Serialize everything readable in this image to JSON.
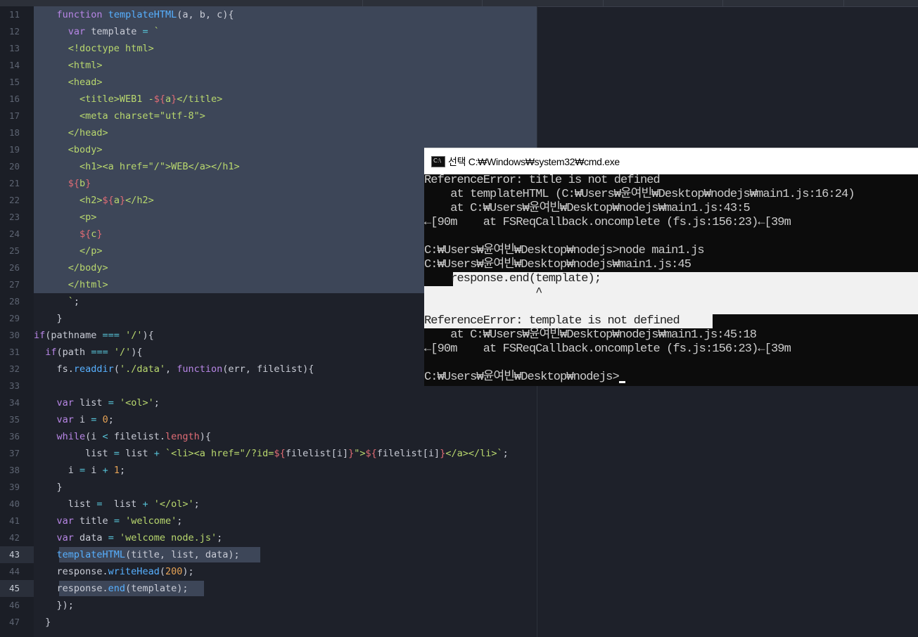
{
  "editor": {
    "lines": [
      {
        "n": "11",
        "parts": [
          [
            "",
            "    "
          ],
          [
            "kw",
            "function"
          ],
          [
            "",
            " "
          ],
          [
            "fn",
            "templateHTML"
          ],
          [
            "",
            "(a, b, c){"
          ]
        ]
      },
      {
        "n": "12",
        "parts": [
          [
            "",
            "      "
          ],
          [
            "kw",
            "var"
          ],
          [
            "",
            " template "
          ],
          [
            "op",
            "="
          ],
          [
            "",
            " "
          ],
          [
            "str",
            "`"
          ]
        ]
      },
      {
        "n": "13",
        "parts": [
          [
            "",
            "      "
          ],
          [
            "tag",
            "<!doctype html>"
          ]
        ]
      },
      {
        "n": "14",
        "parts": [
          [
            "",
            "      "
          ],
          [
            "tag",
            "<html>"
          ]
        ]
      },
      {
        "n": "15",
        "parts": [
          [
            "",
            "      "
          ],
          [
            "tag",
            "<head>"
          ]
        ]
      },
      {
        "n": "16",
        "parts": [
          [
            "",
            "        "
          ],
          [
            "tag",
            "<title>WEB1 -"
          ],
          [
            "interp",
            "${"
          ],
          [
            "str",
            "a"
          ],
          [
            "interp",
            "}"
          ],
          [
            "tag",
            "</title>"
          ]
        ]
      },
      {
        "n": "17",
        "parts": [
          [
            "",
            "        "
          ],
          [
            "tag",
            "<meta charset=\"utf-8\">"
          ]
        ]
      },
      {
        "n": "18",
        "parts": [
          [
            "",
            "      "
          ],
          [
            "tag",
            "</head>"
          ]
        ]
      },
      {
        "n": "19",
        "parts": [
          [
            "",
            "      "
          ],
          [
            "tag",
            "<body>"
          ]
        ]
      },
      {
        "n": "20",
        "parts": [
          [
            "",
            "        "
          ],
          [
            "tag",
            "<h1><a href=\"/\">WEB</a></h1>"
          ]
        ]
      },
      {
        "n": "21",
        "parts": [
          [
            "",
            "      "
          ],
          [
            "interp",
            "${"
          ],
          [
            "str",
            "b"
          ],
          [
            "interp",
            "}"
          ]
        ]
      },
      {
        "n": "22",
        "parts": [
          [
            "",
            "        "
          ],
          [
            "tag",
            "<h2>"
          ],
          [
            "interp",
            "${"
          ],
          [
            "str",
            "a"
          ],
          [
            "interp",
            "}"
          ],
          [
            "tag",
            "</h2>"
          ]
        ]
      },
      {
        "n": "23",
        "parts": [
          [
            "",
            "        "
          ],
          [
            "tag",
            "<p>"
          ]
        ]
      },
      {
        "n": "24",
        "parts": [
          [
            "",
            "        "
          ],
          [
            "interp",
            "${"
          ],
          [
            "str",
            "c"
          ],
          [
            "interp",
            "}"
          ]
        ]
      },
      {
        "n": "25",
        "parts": [
          [
            "",
            "        "
          ],
          [
            "tag",
            "</p>"
          ]
        ]
      },
      {
        "n": "26",
        "parts": [
          [
            "",
            "      "
          ],
          [
            "tag",
            "</body>"
          ]
        ]
      },
      {
        "n": "27",
        "parts": [
          [
            "",
            "      "
          ],
          [
            "tag",
            "</html>"
          ]
        ]
      },
      {
        "n": "28",
        "parts": [
          [
            "",
            "      "
          ],
          [
            "str",
            "`"
          ],
          [
            "",
            ";"
          ]
        ]
      },
      {
        "n": "29",
        "parts": [
          [
            "",
            "    }"
          ]
        ]
      },
      {
        "n": "30",
        "parts": [
          [
            "kw",
            "if"
          ],
          [
            "",
            "(pathname "
          ],
          [
            "op",
            "==="
          ],
          [
            "",
            " "
          ],
          [
            "str",
            "'/'"
          ],
          [
            "",
            "){"
          ]
        ]
      },
      {
        "n": "31",
        "parts": [
          [
            "",
            "  "
          ],
          [
            "kw",
            "if"
          ],
          [
            "",
            "(path "
          ],
          [
            "op",
            "==="
          ],
          [
            "",
            " "
          ],
          [
            "str",
            "'/'"
          ],
          [
            "",
            "){"
          ]
        ]
      },
      {
        "n": "32",
        "parts": [
          [
            "",
            "    fs."
          ],
          [
            "fn",
            "readdir"
          ],
          [
            "",
            "("
          ],
          [
            "str",
            "'./data'"
          ],
          [
            "",
            ", "
          ],
          [
            "kw",
            "function"
          ],
          [
            "",
            "(err, filelist){"
          ]
        ]
      },
      {
        "n": "33",
        "parts": [
          [
            "",
            ""
          ]
        ]
      },
      {
        "n": "34",
        "parts": [
          [
            "",
            "    "
          ],
          [
            "kw",
            "var"
          ],
          [
            "",
            " list "
          ],
          [
            "op",
            "="
          ],
          [
            "",
            " "
          ],
          [
            "str",
            "'<ol>'"
          ],
          [
            "",
            ";"
          ]
        ]
      },
      {
        "n": "35",
        "parts": [
          [
            "",
            "    "
          ],
          [
            "kw",
            "var"
          ],
          [
            "",
            " i "
          ],
          [
            "op",
            "="
          ],
          [
            "",
            " "
          ],
          [
            "num",
            "0"
          ],
          [
            "",
            ";"
          ]
        ]
      },
      {
        "n": "36",
        "parts": [
          [
            "",
            "    "
          ],
          [
            "kw",
            "while"
          ],
          [
            "",
            "(i "
          ],
          [
            "op",
            "<"
          ],
          [
            "",
            " filelist."
          ],
          [
            "prop",
            "length"
          ],
          [
            "",
            "){"
          ]
        ]
      },
      {
        "n": "37",
        "parts": [
          [
            "",
            "         list "
          ],
          [
            "op",
            "="
          ],
          [
            "",
            " list "
          ],
          [
            "op",
            "+"
          ],
          [
            "",
            " "
          ],
          [
            "str",
            "`<li><a href=\"/?id="
          ],
          [
            "interp",
            "${"
          ],
          [
            "",
            "filelist[i]"
          ],
          [
            "interp",
            "}"
          ],
          [
            "str",
            "\">"
          ],
          [
            "interp",
            "${"
          ],
          [
            "",
            "filelist[i]"
          ],
          [
            "interp",
            "}"
          ],
          [
            "str",
            "</a></li>`"
          ],
          [
            "",
            ";"
          ]
        ]
      },
      {
        "n": "38",
        "parts": [
          [
            "",
            "      i "
          ],
          [
            "op",
            "="
          ],
          [
            "",
            " i "
          ],
          [
            "op",
            "+"
          ],
          [
            "",
            " "
          ],
          [
            "num",
            "1"
          ],
          [
            "",
            ";"
          ]
        ]
      },
      {
        "n": "39",
        "parts": [
          [
            "",
            "    }"
          ]
        ]
      },
      {
        "n": "40",
        "parts": [
          [
            "",
            "      list "
          ],
          [
            "op",
            "="
          ],
          [
            "",
            "  list "
          ],
          [
            "op",
            "+"
          ],
          [
            "",
            " "
          ],
          [
            "str",
            "'</ol>'"
          ],
          [
            "",
            ";"
          ]
        ]
      },
      {
        "n": "41",
        "parts": [
          [
            "",
            "    "
          ],
          [
            "kw",
            "var"
          ],
          [
            "",
            " title "
          ],
          [
            "op",
            "="
          ],
          [
            "",
            " "
          ],
          [
            "str",
            "'welcome'"
          ],
          [
            "",
            ";"
          ]
        ]
      },
      {
        "n": "42",
        "parts": [
          [
            "",
            "    "
          ],
          [
            "kw",
            "var"
          ],
          [
            "",
            " data "
          ],
          [
            "op",
            "="
          ],
          [
            "",
            " "
          ],
          [
            "str",
            "'welcome node.js'"
          ],
          [
            "",
            ";"
          ]
        ]
      },
      {
        "n": "43",
        "parts": [
          [
            "",
            "    "
          ],
          [
            "fn",
            "templateHTML"
          ],
          [
            "",
            "(title, list, data);"
          ]
        ]
      },
      {
        "n": "44",
        "parts": [
          [
            "",
            "    response."
          ],
          [
            "fn",
            "writeHead"
          ],
          [
            "",
            "("
          ],
          [
            "num",
            "200"
          ],
          [
            "",
            ");"
          ]
        ]
      },
      {
        "n": "45",
        "parts": [
          [
            "",
            "    response."
          ],
          [
            "fn",
            "end"
          ],
          [
            "",
            "(template);"
          ]
        ]
      },
      {
        "n": "46",
        "parts": [
          [
            "",
            "    });"
          ]
        ]
      },
      {
        "n": "47",
        "parts": [
          [
            "",
            "  }"
          ]
        ]
      }
    ]
  },
  "console": {
    "title_prefix": "선택",
    "title_path": "C:₩Windows₩system32₩cmd.exe",
    "lines": [
      "ReferenceError: title is not defined",
      "    at templateHTML (C:₩Users₩윤여빈₩Desktop₩nodejs₩main1.js:16:24)",
      "    at C:₩Users₩윤여빈₩Desktop₩nodejs₩main1.js:43:5",
      "←[90m    at FSReqCallback.oncomplete (fs.js:156:23)←[39m",
      "",
      "C:₩Users₩윤여빈₩Desktop₩nodejs>node main1.js",
      "C:₩Users₩윤여빈₩Desktop₩nodejs₩main1.js:45",
      "    response.end(template);",
      "                 ^",
      "",
      "ReferenceError: template is not defined",
      "    at C:₩Users₩윤여빈₩Desktop₩nodejs₩main1.js:45:18",
      "←[90m    at FSReqCallback.oncomplete (fs.js:156:23)←[39m",
      "",
      "C:₩Users₩윤여빈₩Desktop₩nodejs>"
    ]
  }
}
